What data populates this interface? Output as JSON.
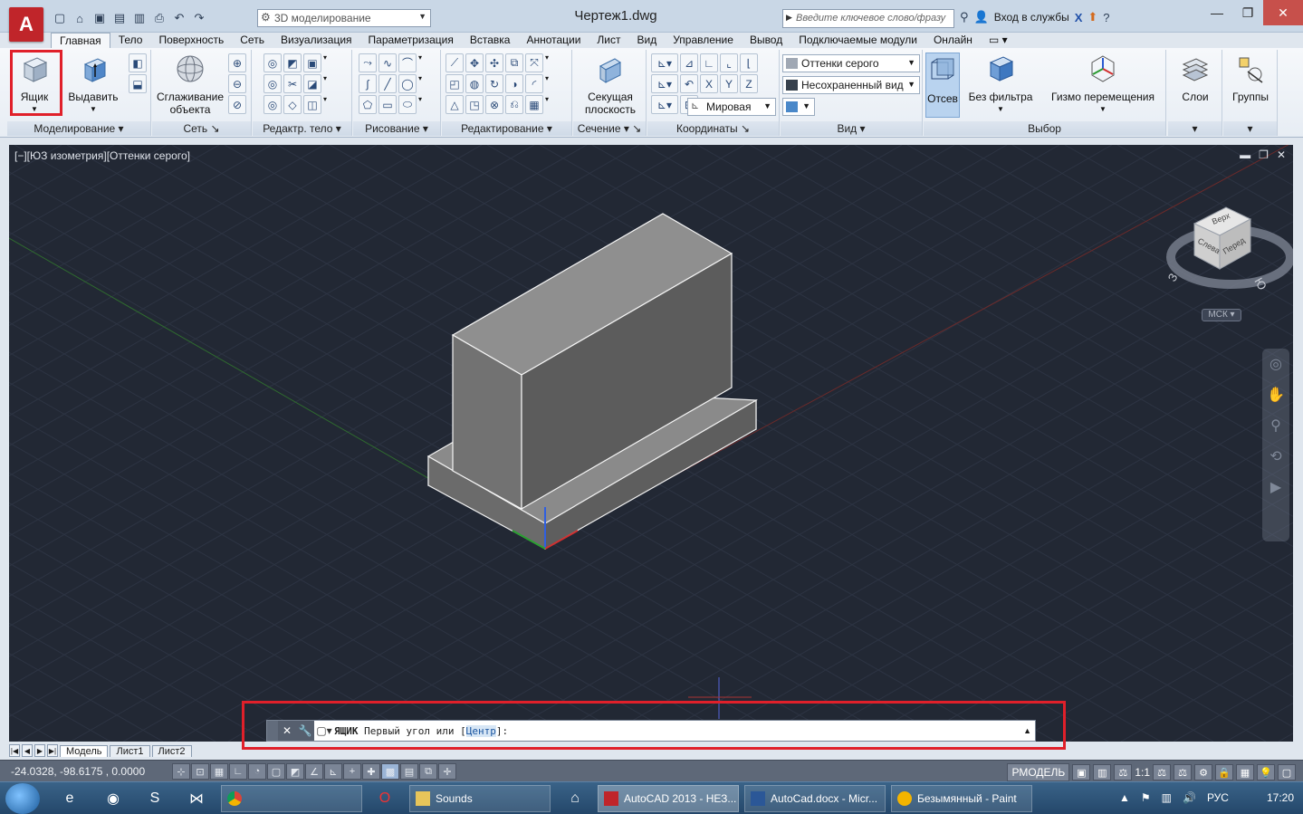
{
  "titlebar": {
    "app_logo": "A",
    "workspace": "3D моделирование",
    "document_title": "Чертеж1.dwg",
    "search_placeholder": "Введите ключевое слово/фразу",
    "signin": "Вход в службы"
  },
  "tabs": [
    "Главная",
    "Тело",
    "Поверхность",
    "Сеть",
    "Визуализация",
    "Параметризация",
    "Вставка",
    "Аннотации",
    "Лист",
    "Вид",
    "Управление",
    "Вывод",
    "Подключаемые модули",
    "Онлайн"
  ],
  "ribbon": {
    "modeling": {
      "title": "Моделирование",
      "box": "Ящик",
      "extrude": "Выдавить"
    },
    "mesh": {
      "title": "Сеть",
      "smooth_line1": "Сглаживание",
      "smooth_line2": "объекта"
    },
    "solid_edit": {
      "title": "Редактр. тело"
    },
    "draw": {
      "title": "Рисование"
    },
    "modify": {
      "title": "Редактирование"
    },
    "section": {
      "title": "Сечение",
      "plane_line1": "Секущая",
      "plane_line2": "плоскость"
    },
    "coordinates": {
      "title": "Координаты",
      "world": "Мировая"
    },
    "view": {
      "title": "Вид",
      "visual_style": "Оттенки серого",
      "named_view": "Несохраненный вид"
    },
    "selection": {
      "title": "Выбор",
      "culling": "Отсев",
      "no_filter": "Без фильтра",
      "gizmo": "Гизмо перемещения"
    },
    "layers": "Слои",
    "groups": "Группы"
  },
  "viewport": {
    "label": "[−][ЮЗ изометрия][Оттенки серого]",
    "viewcube_top": "Верх",
    "viewcube_left": "Слева",
    "viewcube_front": "Перед",
    "compass_w": "З",
    "compass_s": "Ю",
    "ucs_label": "МСК"
  },
  "command": {
    "keyword": "ЯЩИК",
    "prompt": " Первый угол или [",
    "option": "Центр",
    "suffix": "]:"
  },
  "layout_tabs": [
    "Модель",
    "Лист1",
    "Лист2"
  ],
  "status": {
    "coords": "-24.0328, -98.6175 , 0.0000",
    "space": "РМОДЕЛЬ",
    "scale": "1:1"
  },
  "taskbar": {
    "tasks": [
      "Sounds",
      "AutoCAD 2013 - НЕЗ...",
      "AutoCad.docx - Micr...",
      "Безымянный - Paint"
    ],
    "lang": "РУС",
    "time": "17:20"
  },
  "colors": {
    "viewport_bg": "#222834",
    "highlight": "#e0202a",
    "solid_top": "#8a8a8a",
    "solid_front": "#6e6e6e",
    "solid_side": "#595959"
  }
}
